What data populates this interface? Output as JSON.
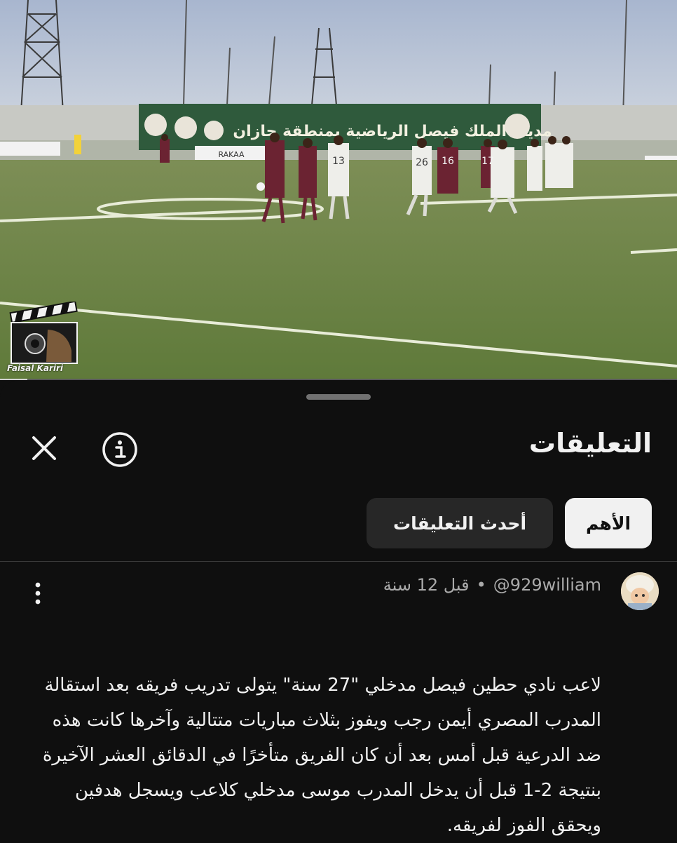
{
  "video": {
    "watermark_label": "Faisal Kariri",
    "progress_fraction": 0.04,
    "banner_text": "مدينة الملك فيصل الرياضية بمنطقة جازان",
    "ad_text": "RAKAA",
    "jersey_numbers": [
      "13",
      "16",
      "26",
      "17"
    ]
  },
  "comments_sheet": {
    "title": "التعليقات",
    "close_icon": "close-icon",
    "info_icon": "info-icon",
    "sort_chips": [
      {
        "label": "الأهم",
        "selected": true
      },
      {
        "label": "أحدث التعليقات",
        "selected": false
      }
    ]
  },
  "comment": {
    "author": "@929william",
    "separator": "•",
    "time": "قبل 12 سنة",
    "menu_icon": "more-vert-icon",
    "text": "لاعب نادي حطين فيصل مدخلي \"27 سنة\" يتولى تدريب فريقه بعد استقالة المدرب المصري أيمن رجب ويفوز بثلاث مباريات متتالية وآخرها كانت هذه ضد الدرعية قبل أمس بعد أن كان الفريق متأخرًا في الدقائق العشر الآخيرة بنتيجة 2-1 قبل أن يدخل المدرب موسى مدخلي كلاعب ويسجل هدفين ويحقق الفوز لفريقه."
  },
  "colors": {
    "background": "#0f0f0f",
    "chip_selected": "#f1f1f1",
    "chip_unselected": "#272727",
    "secondary_text": "#aaaaaa"
  }
}
